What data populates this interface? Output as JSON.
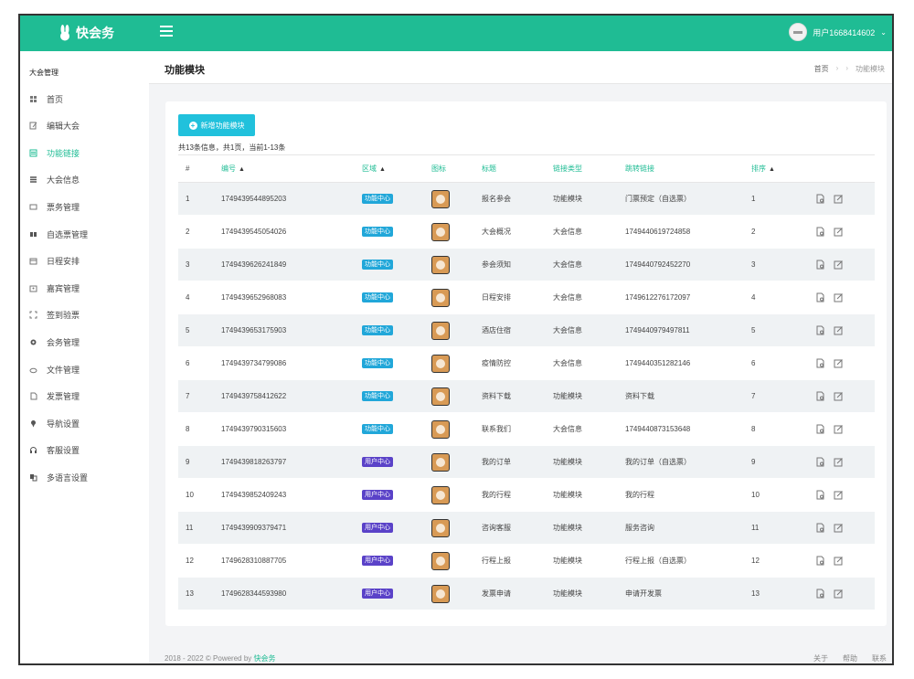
{
  "app": {
    "name": "快会务",
    "user": "用户1668414602"
  },
  "sidebar": {
    "title": "大会管理",
    "items": [
      {
        "label": "首页",
        "icon": "grid-icon",
        "active": false
      },
      {
        "label": "编辑大会",
        "icon": "edit-icon",
        "active": false
      },
      {
        "label": "功能链接",
        "icon": "list-icon",
        "active": true
      },
      {
        "label": "大会信息",
        "icon": "info-list-icon",
        "active": false
      },
      {
        "label": "票务管理",
        "icon": "ticket-icon",
        "active": false
      },
      {
        "label": "自选票管理",
        "icon": "blocks-icon",
        "active": false
      },
      {
        "label": "日程安排",
        "icon": "calendar-icon",
        "active": false
      },
      {
        "label": "嘉宾管理",
        "icon": "guest-icon",
        "active": false
      },
      {
        "label": "签到验票",
        "icon": "scan-icon",
        "active": false
      },
      {
        "label": "会务管理",
        "icon": "gear-icon",
        "active": false
      },
      {
        "label": "文件管理",
        "icon": "cloud-icon",
        "active": false
      },
      {
        "label": "发票管理",
        "icon": "invoice-icon",
        "active": false
      },
      {
        "label": "导航设置",
        "icon": "location-icon",
        "active": false
      },
      {
        "label": "客服设置",
        "icon": "headset-icon",
        "active": false
      },
      {
        "label": "多语言设置",
        "icon": "language-icon",
        "active": false
      }
    ]
  },
  "header": {
    "title": "功能模块",
    "breadcrumb": [
      "首页",
      "功能模块"
    ]
  },
  "toolbar": {
    "add_label": "新增功能模块"
  },
  "summary": "共13条信息，共1页，当前1-13条",
  "table": {
    "columns": [
      "#",
      "编号",
      "区域",
      "图标",
      "标题",
      "链接类型",
      "跳转链接",
      "排序",
      ""
    ],
    "rows": [
      {
        "no": "1",
        "id": "1749439544895203",
        "area": "功能中心",
        "title": "报名参会",
        "type": "功能模块",
        "link": "门票预定（自选票）",
        "order": "1"
      },
      {
        "no": "2",
        "id": "1749439545054026",
        "area": "功能中心",
        "title": "大会概况",
        "type": "大会信息",
        "link": "1749440619724858",
        "order": "2"
      },
      {
        "no": "3",
        "id": "1749439626241849",
        "area": "功能中心",
        "title": "参会须知",
        "type": "大会信息",
        "link": "1749440792452270",
        "order": "3"
      },
      {
        "no": "4",
        "id": "1749439652968083",
        "area": "功能中心",
        "title": "日程安排",
        "type": "大会信息",
        "link": "1749612276172097",
        "order": "4"
      },
      {
        "no": "5",
        "id": "1749439653175903",
        "area": "功能中心",
        "title": "酒店住宿",
        "type": "大会信息",
        "link": "1749440979497811",
        "order": "5"
      },
      {
        "no": "6",
        "id": "1749439734799086",
        "area": "功能中心",
        "title": "疫情防控",
        "type": "大会信息",
        "link": "1749440351282146",
        "order": "6"
      },
      {
        "no": "7",
        "id": "1749439758412622",
        "area": "功能中心",
        "title": "资料下载",
        "type": "功能模块",
        "link": "资料下载",
        "order": "7"
      },
      {
        "no": "8",
        "id": "1749439790315603",
        "area": "功能中心",
        "title": "联系我们",
        "type": "大会信息",
        "link": "1749440873153648",
        "order": "8"
      },
      {
        "no": "9",
        "id": "1749439818263797",
        "area": "用户中心",
        "title": "我的订单",
        "type": "功能模块",
        "link": "我的订单（自选票）",
        "order": "9"
      },
      {
        "no": "10",
        "id": "1749439852409243",
        "area": "用户中心",
        "title": "我的行程",
        "type": "功能模块",
        "link": "我的行程",
        "order": "10"
      },
      {
        "no": "11",
        "id": "1749439909379471",
        "area": "用户中心",
        "title": "咨询客服",
        "type": "功能模块",
        "link": "服务咨询",
        "order": "11"
      },
      {
        "no": "12",
        "id": "1749628310887705",
        "area": "用户中心",
        "title": "行程上报",
        "type": "功能模块",
        "link": "行程上报（自选票）",
        "order": "12"
      },
      {
        "no": "13",
        "id": "1749628344593980",
        "area": "用户中心",
        "title": "发票申请",
        "type": "功能模块",
        "link": "申请开发票",
        "order": "13"
      }
    ]
  },
  "colors": {
    "brand": "#1fbc94",
    "area_function": "#21a7d9",
    "area_user": "#5a42c8",
    "button": "#21c1dc"
  },
  "footer": {
    "copy": "2018 - 2022 © Powered by",
    "brand": "快会务",
    "links": [
      "关于",
      "帮助",
      "联系"
    ]
  }
}
